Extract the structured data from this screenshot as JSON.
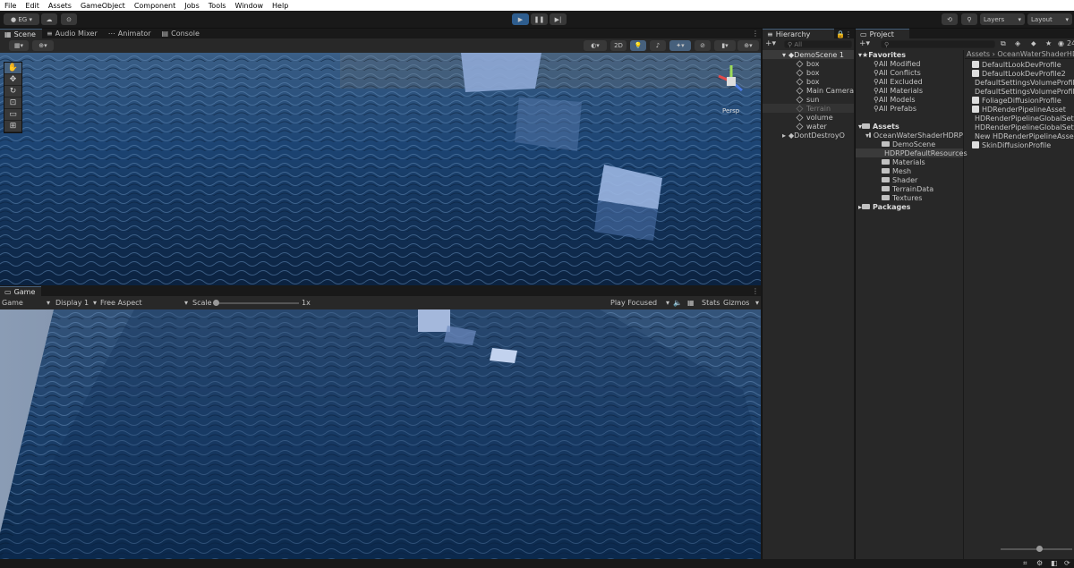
{
  "menu": [
    "File",
    "Edit",
    "Assets",
    "GameObject",
    "Component",
    "Jobs",
    "Tools",
    "Window",
    "Help"
  ],
  "toolbar": {
    "account": "EG",
    "layers": "Layers",
    "layout": "Layout"
  },
  "scene_tabs": [
    "Scene",
    "Audio Mixer",
    "Animator",
    "Console"
  ],
  "scene_toolbar": {
    "mode_2d": "2D",
    "persp": "Persp"
  },
  "game": {
    "tab": "Game",
    "display_mode": "Game",
    "display": "Display 1",
    "aspect": "Free Aspect",
    "scale_label": "Scale",
    "scale_value": "1x",
    "play_focused": "Play Focused",
    "stats": "Stats",
    "gizmos": "Gizmos"
  },
  "hierarchy": {
    "tab": "Hierarchy",
    "search_placeholder": "All",
    "scene": "DemoScene 1",
    "items": [
      "box",
      "box",
      "box",
      "Main Camera",
      "sun",
      "Terrain",
      "volume",
      "water"
    ],
    "dont_destroy": "DontDestroyO"
  },
  "project": {
    "tab": "Project",
    "count": "24",
    "favorites_label": "Favorites",
    "favorites": [
      "All Modified",
      "All Conflicts",
      "All Excluded",
      "All Materials",
      "All Models",
      "All Prefabs"
    ],
    "assets_label": "Assets",
    "root_folder": "OceanWaterShaderHDRP",
    "subfolders": [
      "DemoScene",
      "HDRPDefaultResources",
      "Materials",
      "Mesh",
      "Shader",
      "TerrainData",
      "Textures"
    ],
    "packages_label": "Packages",
    "breadcrumb_root": "Assets",
    "breadcrumb_child": "OceanWaterShaderHDR",
    "files": [
      "DefaultLookDevProfile",
      "DefaultLookDevProfile2",
      "DefaultSettingsVolumeProfile",
      "DefaultSettingsVolumeProfile",
      "FoliageDiffusionProfile",
      "HDRenderPipelineAsset",
      "HDRenderPipelineGlobalSett",
      "HDRenderPipelineGlobalSett",
      "New HDRenderPipelineAsset",
      "SkinDiffusionProfile"
    ]
  },
  "colors": {
    "accent": "#46607c",
    "play": "#2e5d8e",
    "water_deep": "#0d2a4c",
    "water_light": "#3f6d9c"
  }
}
